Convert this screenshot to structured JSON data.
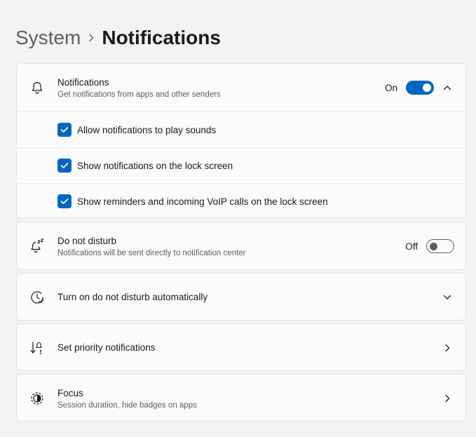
{
  "breadcrumb": {
    "parent": "System",
    "current": "Notifications"
  },
  "notifications": {
    "title": "Notifications",
    "subtitle": "Get notifications from apps and other senders",
    "toggle_label": "On",
    "toggle_on": true,
    "icon": "bell-icon",
    "options": [
      {
        "label": "Allow notifications to play sounds",
        "checked": true
      },
      {
        "label": "Show notifications on the lock screen",
        "checked": true
      },
      {
        "label": "Show reminders and incoming VoIP calls on the lock screen",
        "checked": true
      }
    ]
  },
  "do_not_disturb": {
    "title": "Do not disturb",
    "subtitle": "Notifications will be sent directly to notification center",
    "toggle_label": "Off",
    "toggle_on": false,
    "icon": "bell-snooze-icon"
  },
  "dnd_auto": {
    "title": "Turn on do not disturb automatically",
    "icon": "clock-icon"
  },
  "priority": {
    "title": "Set priority notifications",
    "icon": "priority-icon"
  },
  "focus": {
    "title": "Focus",
    "subtitle": "Session duration, hide badges on apps",
    "icon": "focus-icon"
  },
  "colors": {
    "accent": "#0067c0",
    "background": "#f3f3f3",
    "card": "#fbfbfb"
  }
}
